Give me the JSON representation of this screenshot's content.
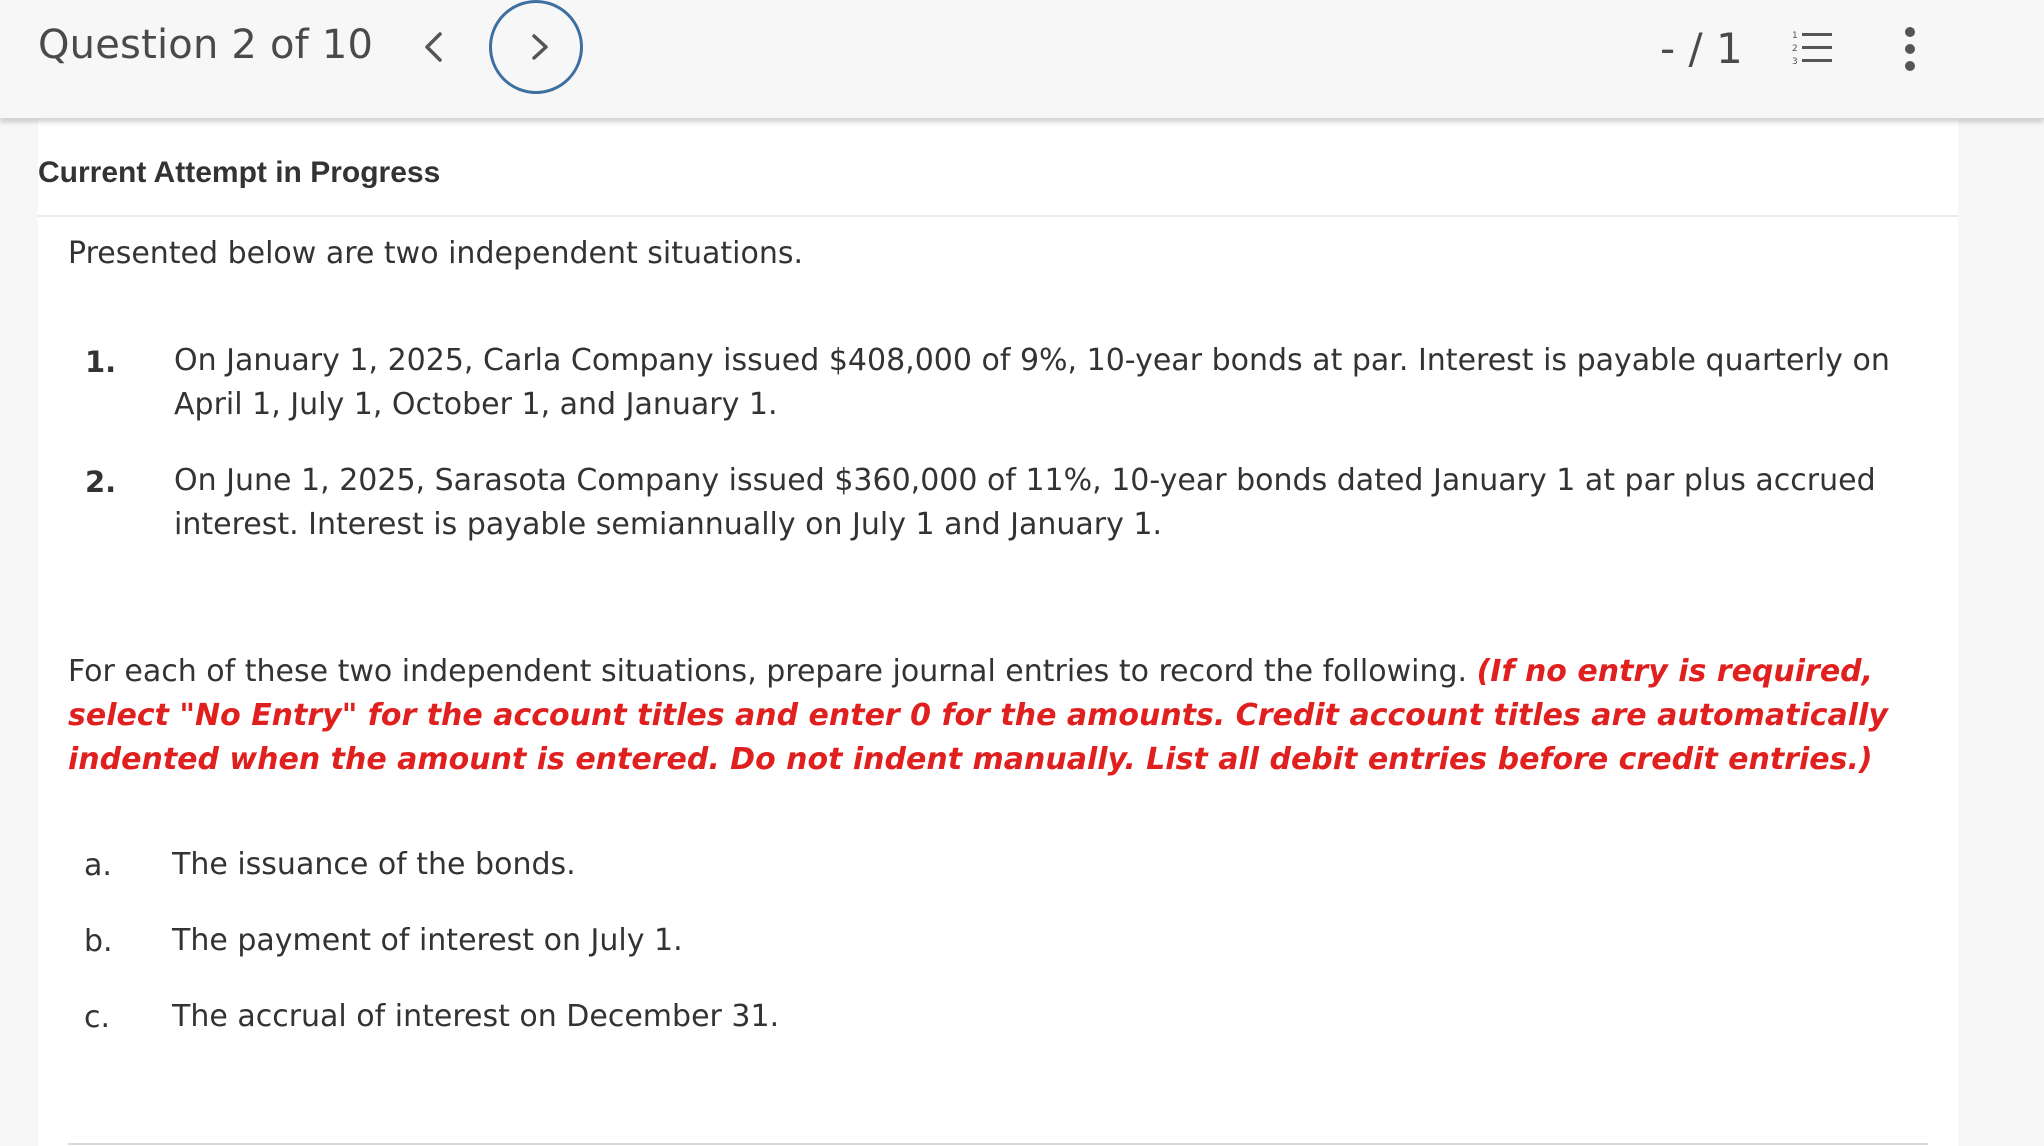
{
  "header": {
    "question_counter": "Question 2 of 10",
    "score": "- / 1",
    "prev_icon": "chevron-left-icon",
    "next_icon": "chevron-right-icon",
    "list_icon": "numbered-list-icon",
    "more_icon": "vertical-ellipsis-icon",
    "accent_color": "#3d6fa0"
  },
  "attempt": {
    "label": "Current Attempt in Progress"
  },
  "problem": {
    "intro": "Presented below are two independent situations.",
    "situations": [
      {
        "number": "1.",
        "text": "On January 1, 2025, Carla Company issued $408,000 of 9%, 10-year bonds at par. Interest is payable quarterly on April 1, July 1, October 1, and January 1."
      },
      {
        "number": "2.",
        "text": "On June 1, 2025, Sarasota Company issued $360,000 of 11%, 10-year bonds dated January 1 at par plus accrued interest. Interest is payable semiannually on July 1 and January 1."
      }
    ],
    "instruction_plain": "For each of these two independent situations, prepare journal entries to record the following. ",
    "instruction_red": "(If no entry is required, select \"No Entry\" for the account titles and enter 0 for the amounts. Credit account titles are automatically indented when the amount is entered. Do not indent manually. List all debit entries before credit entries.)",
    "instruction_red_color": "#e01f1f",
    "parts": [
      {
        "letter": "a.",
        "text": "The issuance of the bonds."
      },
      {
        "letter": "b.",
        "text": "The payment of interest on July 1."
      },
      {
        "letter": "c.",
        "text": "The accrual of interest on December 31."
      }
    ]
  }
}
